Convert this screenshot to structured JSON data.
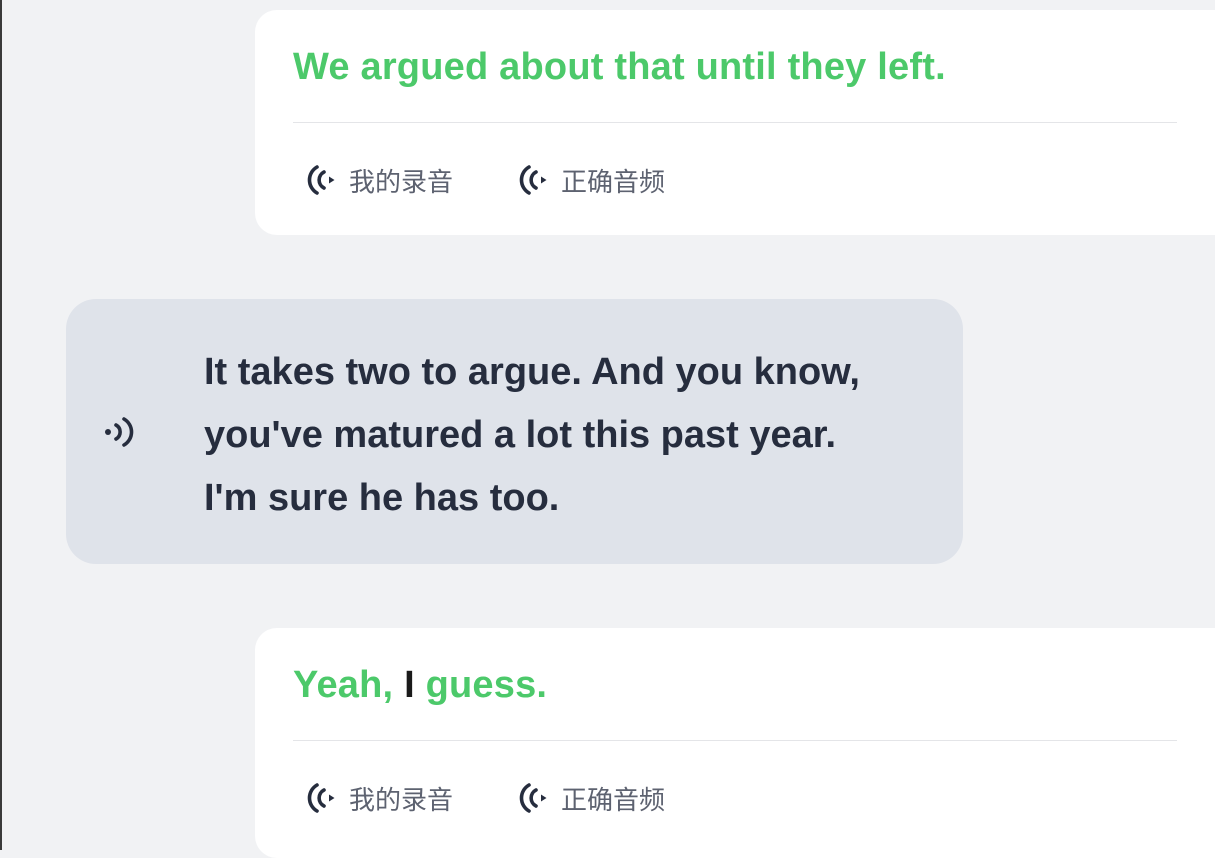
{
  "conversation": {
    "turn1": {
      "words": [
        {
          "text": "We",
          "status": "correct"
        },
        {
          "text": "argued",
          "status": "correct"
        },
        {
          "text": "about",
          "status": "correct"
        },
        {
          "text": "that",
          "status": "correct"
        },
        {
          "text": "until",
          "status": "correct"
        },
        {
          "text": "they",
          "status": "correct"
        },
        {
          "text": "left.",
          "status": "correct"
        }
      ],
      "my_recording_label": "我的录音",
      "correct_audio_label": "正确音频"
    },
    "turn2": {
      "lines": [
        "It takes two to argue. And you know,",
        "you've matured a lot this past year.",
        "I'm sure he has too."
      ]
    },
    "turn3": {
      "words": [
        {
          "text": "Yeah,",
          "status": "correct"
        },
        {
          "text": "I",
          "status": "incorrect"
        },
        {
          "text": "guess.",
          "status": "correct"
        }
      ],
      "my_recording_label": "我的录音",
      "correct_audio_label": "正确音频"
    }
  },
  "colors": {
    "correct": "#4cc96a",
    "incorrect": "#1a1a1a",
    "background": "#f1f2f4",
    "card": "#ffffff",
    "bot_bubble": "#dfe3ea",
    "icon": "#262d3e"
  },
  "icons": {
    "recording": "radio-wave-icon",
    "speaker": "speaker-icon"
  }
}
